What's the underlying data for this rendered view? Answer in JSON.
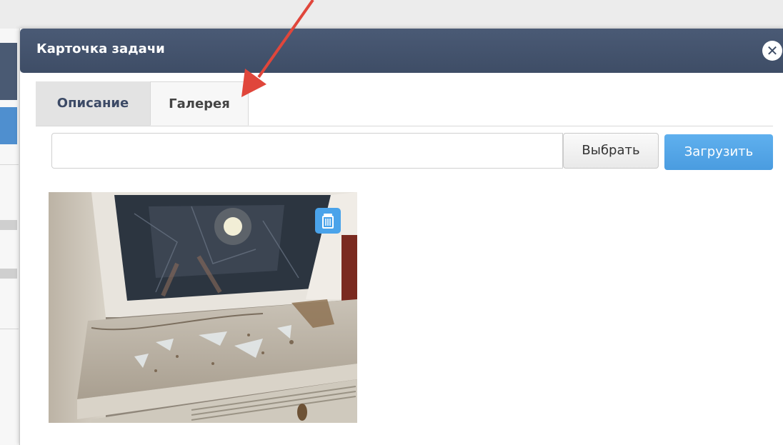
{
  "dialog": {
    "title": "Карточка задачи",
    "close_icon": "close-circle-icon"
  },
  "tabs": [
    {
      "label": "Описание",
      "active": false
    },
    {
      "label": "Галерея",
      "active": true
    }
  ],
  "upload": {
    "file_value": "",
    "choose_label": "Выбрать",
    "upload_label": "Загрузить"
  },
  "gallery": {
    "items": [
      {
        "kind": "photo",
        "description_icon": "broken-window-photo",
        "delete_icon": "trash-icon"
      }
    ]
  },
  "annotation": {
    "arrow_icon": "red-arrow-icon",
    "color": "#e0463b"
  },
  "colors": {
    "header": "#44536c",
    "primary_button": "#4fa3e6",
    "active_tab_text": "#3c4a66"
  }
}
